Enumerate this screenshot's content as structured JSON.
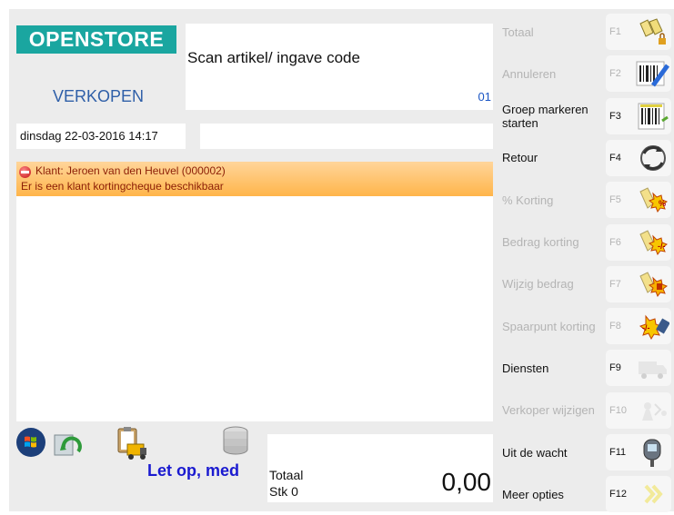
{
  "header": {
    "logo": "OPENSTORE",
    "section_title": "VERKOPEN"
  },
  "scan": {
    "label": "Scan artikel/ ingave code",
    "code": "01"
  },
  "datetime": "dinsdag 22-03-2016 14:17",
  "customer": {
    "name": "Klant: Jeroen van den Heuvel (000002)",
    "message": "Er is een klant kortingcheque beschikbaar"
  },
  "warning": "Let op, med",
  "totals": {
    "label": "Totaal",
    "qty_label": "Stk",
    "qty": "0",
    "value": "0,00"
  },
  "menu": [
    {
      "label": "Totaal",
      "key": "F1",
      "enabled": false,
      "icon": "bags-lock-icon"
    },
    {
      "label": "Annuleren",
      "key": "F2",
      "enabled": false,
      "icon": "barcode-cancel-icon"
    },
    {
      "label": "Groep markeren starten",
      "key": "F3",
      "enabled": true,
      "icon": "barcode-group-icon"
    },
    {
      "label": "Retour",
      "key": "F4",
      "enabled": true,
      "icon": "return-arrows-icon"
    },
    {
      "label": "% Korting",
      "key": "F5",
      "enabled": false,
      "icon": "bag-percent-icon"
    },
    {
      "label": "Bedrag korting",
      "key": "F6",
      "enabled": false,
      "icon": "bag-amount-icon"
    },
    {
      "label": "Wijzig bedrag",
      "key": "F7",
      "enabled": false,
      "icon": "bag-edit-icon"
    },
    {
      "label": "Spaarpunt korting",
      "key": "F8",
      "enabled": false,
      "icon": "points-discount-icon"
    },
    {
      "label": "Diensten",
      "key": "F9",
      "enabled": true,
      "icon": "delivery-truck-icon"
    },
    {
      "label": "Verkoper wijzigen",
      "key": "F10",
      "enabled": false,
      "icon": "seller-change-icon"
    },
    {
      "label": "Uit de wacht",
      "key": "F11",
      "enabled": true,
      "icon": "parking-meter-icon"
    },
    {
      "label": "Meer opties",
      "key": "F12",
      "enabled": true,
      "icon": "double-chevron-icon"
    }
  ]
}
